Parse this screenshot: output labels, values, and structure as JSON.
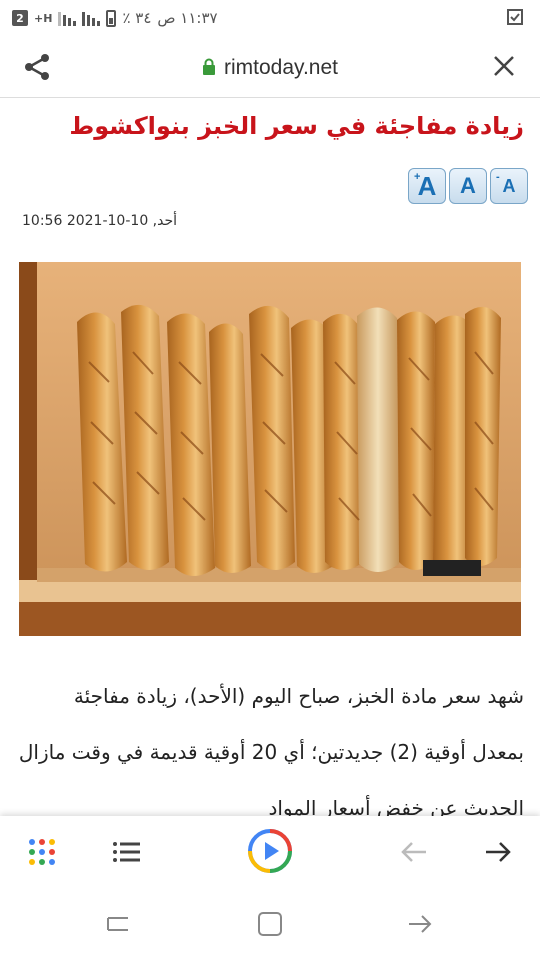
{
  "status": {
    "time": "١١:٣٧ ص",
    "battery": "٣٤ ٪",
    "network": "H+",
    "sim_badge": "2"
  },
  "browser": {
    "url": "rimtoday.net"
  },
  "article": {
    "title": "زيادة مفاجئة في سعر الخبز بنواكشوط",
    "date": "أحد, 10-10-2021 10:56",
    "body": "شهد سعر مادة الخبز، صباح اليوم (الأحد)، زيادة مفاجئة بمعدل أوقية (2) جديدتين؛ أي 20 أوقية قديمة في وقت مازال الحديث عن خفض أسعار المواد",
    "font_buttons": [
      "+A",
      "A",
      "-A"
    ]
  },
  "colors": {
    "title": "#c8141b",
    "lock": "#3a9a3a"
  }
}
